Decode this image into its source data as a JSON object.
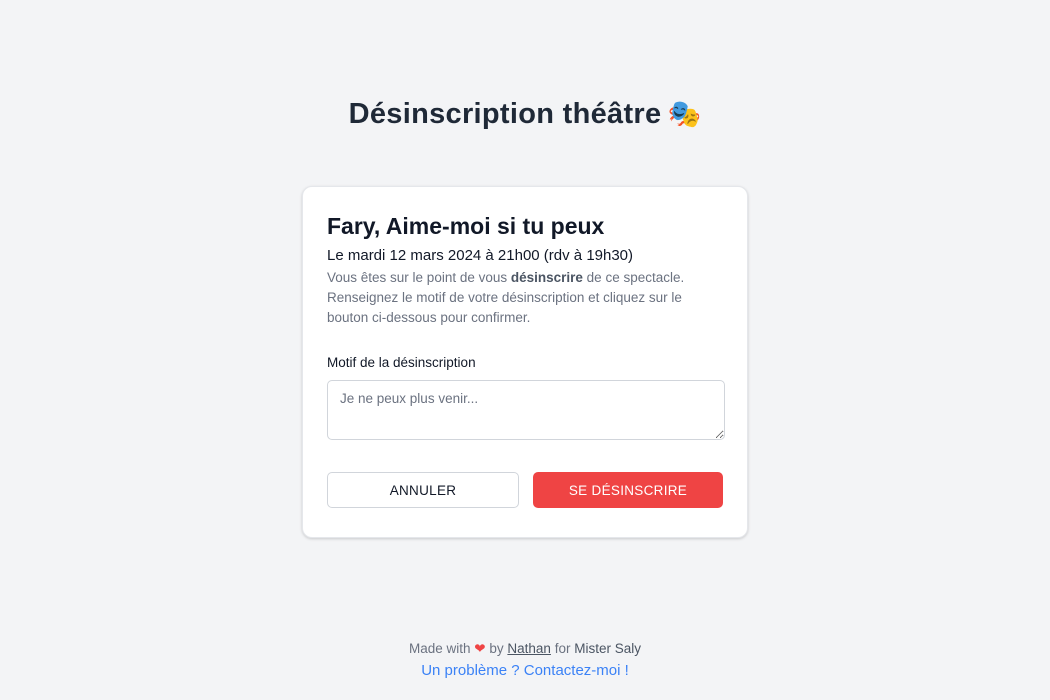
{
  "page": {
    "title": "Désinscription théâtre",
    "title_emoji": "🎭"
  },
  "event": {
    "title": "Fary, Aime-moi si tu peux",
    "date": "Le mardi 12 mars 2024 à 21h00 (rdv à 19h30)",
    "desc_before": "Vous êtes sur le point de vous ",
    "desc_bold": "désinscrire",
    "desc_after": " de ce spectacle. Renseignez le motif de votre désinscription et cliquez sur le bouton ci-dessous pour confirmer."
  },
  "form": {
    "reason_label": "Motif de la désinscription",
    "reason_placeholder": "Je ne peux plus venir...",
    "reason_value": "",
    "cancel_label": "ANNULER",
    "unsubscribe_label": "SE DÉSINSCRIRE"
  },
  "footer": {
    "made_with": "Made with",
    "heart": "❤",
    "by": "by",
    "author": "Nathan",
    "for": "for",
    "client": "Mister Saly",
    "contact_link": "Un problème ? Contactez-moi !"
  },
  "colors": {
    "background": "#f3f4f6",
    "danger": "#ef4444",
    "link": "#3b82f6"
  }
}
